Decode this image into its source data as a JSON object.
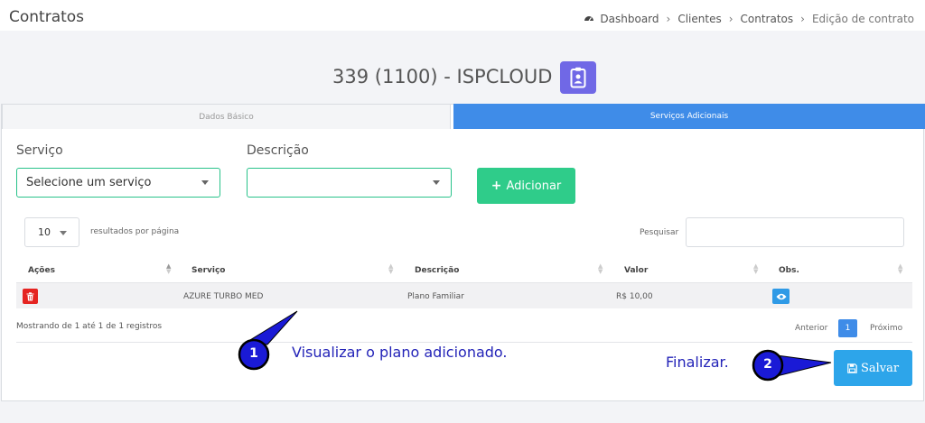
{
  "header": {
    "title": "Contratos",
    "breadcrumb": [
      "Dashboard",
      "Clientes",
      "Contratos",
      "Edição de contrato"
    ]
  },
  "contract": {
    "title": "339 (1100) - ISPCLOUD"
  },
  "tabs": [
    {
      "label": "Dados Básico"
    },
    {
      "label": "Serviços Adicionais"
    }
  ],
  "form": {
    "service_label": "Serviço",
    "service_value": "Selecione um serviço",
    "description_label": "Descrição",
    "description_value": "",
    "add_label": "Adicionar"
  },
  "table": {
    "per_page_value": "10",
    "per_page_label": "resultados por página",
    "search_label": "Pesquisar",
    "columns": [
      "Ações",
      "Serviço",
      "Descrição",
      "Valor",
      "Obs."
    ],
    "rows": [
      {
        "service": "AZURE TURBO MED",
        "description": "Plano Familiar",
        "value": "R$ 10,00"
      }
    ],
    "info": "Mostrando de 1 até 1 de 1 registros",
    "pagination": {
      "prev": "Anterior",
      "current": "1",
      "next": "Próximo"
    }
  },
  "save_label": "Salvar",
  "annotations": [
    {
      "number": "1",
      "text": "Visualizar o plano adicionado."
    },
    {
      "number": "2",
      "text": "Finalizar."
    }
  ],
  "colors": {
    "tab_active": "#3f8ce8",
    "add_button": "#2fcc8a",
    "save_button": "#2da5ea",
    "delete_button": "#e52421",
    "view_button": "#2f9ae6",
    "badge": "#7068e6",
    "annotation": "#2424b8"
  }
}
